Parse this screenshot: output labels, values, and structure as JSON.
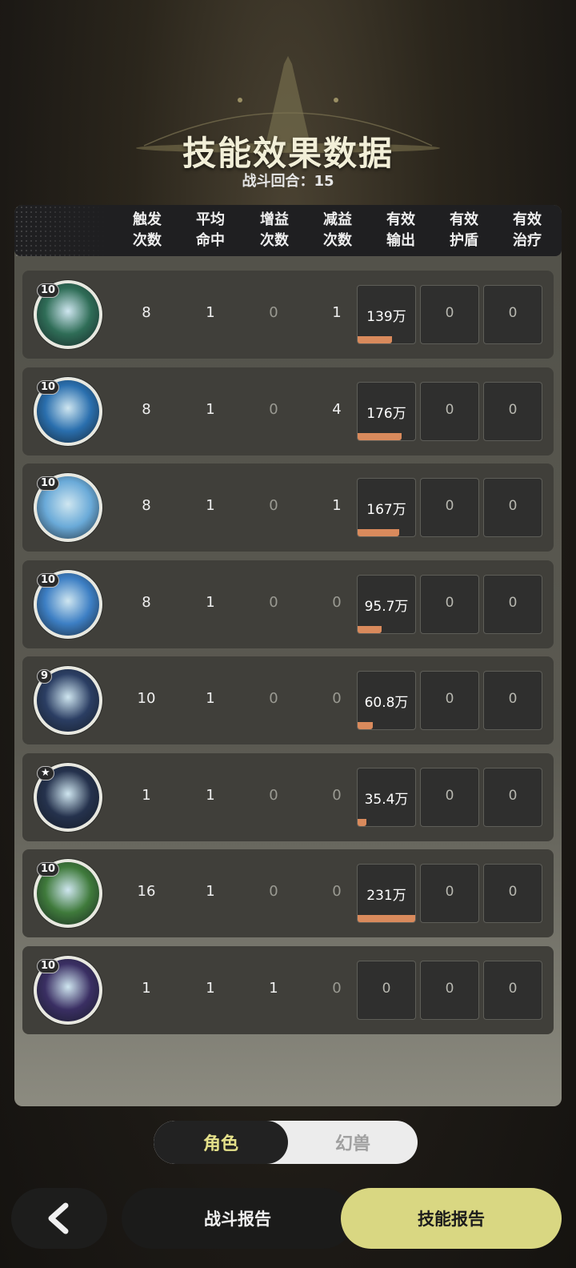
{
  "header": {
    "title": "技能效果数据",
    "round_text": "战斗回合：15"
  },
  "columns": [
    {
      "line1": "触发",
      "line2": "次数"
    },
    {
      "line1": "平均",
      "line2": "命中"
    },
    {
      "line1": "增益",
      "line2": "次数"
    },
    {
      "line1": "减益",
      "line2": "次数"
    },
    {
      "line1": "有效",
      "line2": "输出"
    },
    {
      "line1": "有效",
      "line2": "护盾"
    },
    {
      "line1": "有效",
      "line2": "治疗"
    }
  ],
  "rows": [
    {
      "icon": "thorn-vine-skill-icon",
      "level": "10",
      "trigger": "8",
      "hit": "1",
      "buff": "0",
      "debuff": "1",
      "output": "139万",
      "output_fraction": 0.6,
      "shield": "0",
      "heal": "0",
      "icon_color": "#2f6d57"
    },
    {
      "icon": "water-vortex-skill-icon",
      "level": "10",
      "trigger": "8",
      "hit": "1",
      "buff": "0",
      "debuff": "4",
      "output": "176万",
      "output_fraction": 0.76,
      "shield": "0",
      "heal": "0",
      "icon_color": "#2a6fae"
    },
    {
      "icon": "ice-crystal-burst-skill-icon",
      "level": "10",
      "trigger": "8",
      "hit": "1",
      "buff": "0",
      "debuff": "1",
      "output": "167万",
      "output_fraction": 0.72,
      "shield": "0",
      "heal": "0",
      "icon_color": "#6aaad8"
    },
    {
      "icon": "ice-shard-skill-icon",
      "level": "10",
      "trigger": "8",
      "hit": "1",
      "buff": "0",
      "debuff": "0",
      "output": "95.7万",
      "output_fraction": 0.41,
      "shield": "0",
      "heal": "0",
      "icon_color": "#3d7fc4"
    },
    {
      "icon": "ice-wave-skill-icon",
      "level": "9",
      "trigger": "10",
      "hit": "1",
      "buff": "0",
      "debuff": "0",
      "output": "60.8万",
      "output_fraction": 0.26,
      "shield": "0",
      "heal": "0",
      "icon_color": "#2b3e63"
    },
    {
      "icon": "ice-crystals-skill-icon",
      "level": "★",
      "trigger": "1",
      "hit": "1",
      "buff": "0",
      "debuff": "0",
      "output": "35.4万",
      "output_fraction": 0.15,
      "shield": "0",
      "heal": "0",
      "icon_color": "#25324d"
    },
    {
      "icon": "wind-slash-skill-icon",
      "level": "10",
      "trigger": "16",
      "hit": "1",
      "buff": "0",
      "debuff": "0",
      "output": "231万",
      "output_fraction": 1.0,
      "shield": "0",
      "heal": "0",
      "icon_color": "#3f7a3b"
    },
    {
      "icon": "arcane-clock-skill-icon",
      "level": "10",
      "trigger": "1",
      "hit": "1",
      "buff": "1",
      "debuff": "0",
      "output": "0",
      "output_fraction": 0,
      "shield": "0",
      "heal": "0",
      "icon_color": "#3a2f63"
    }
  ],
  "toggle": {
    "active": "角色",
    "inactive": "幻兽"
  },
  "footer": {
    "battle_report": "战斗报告",
    "skill_report": "技能报告"
  },
  "colors": {
    "accent_bar": "#d98a5c",
    "primary_button": "#d9d782",
    "active_toggle_text": "#e4e08a"
  }
}
